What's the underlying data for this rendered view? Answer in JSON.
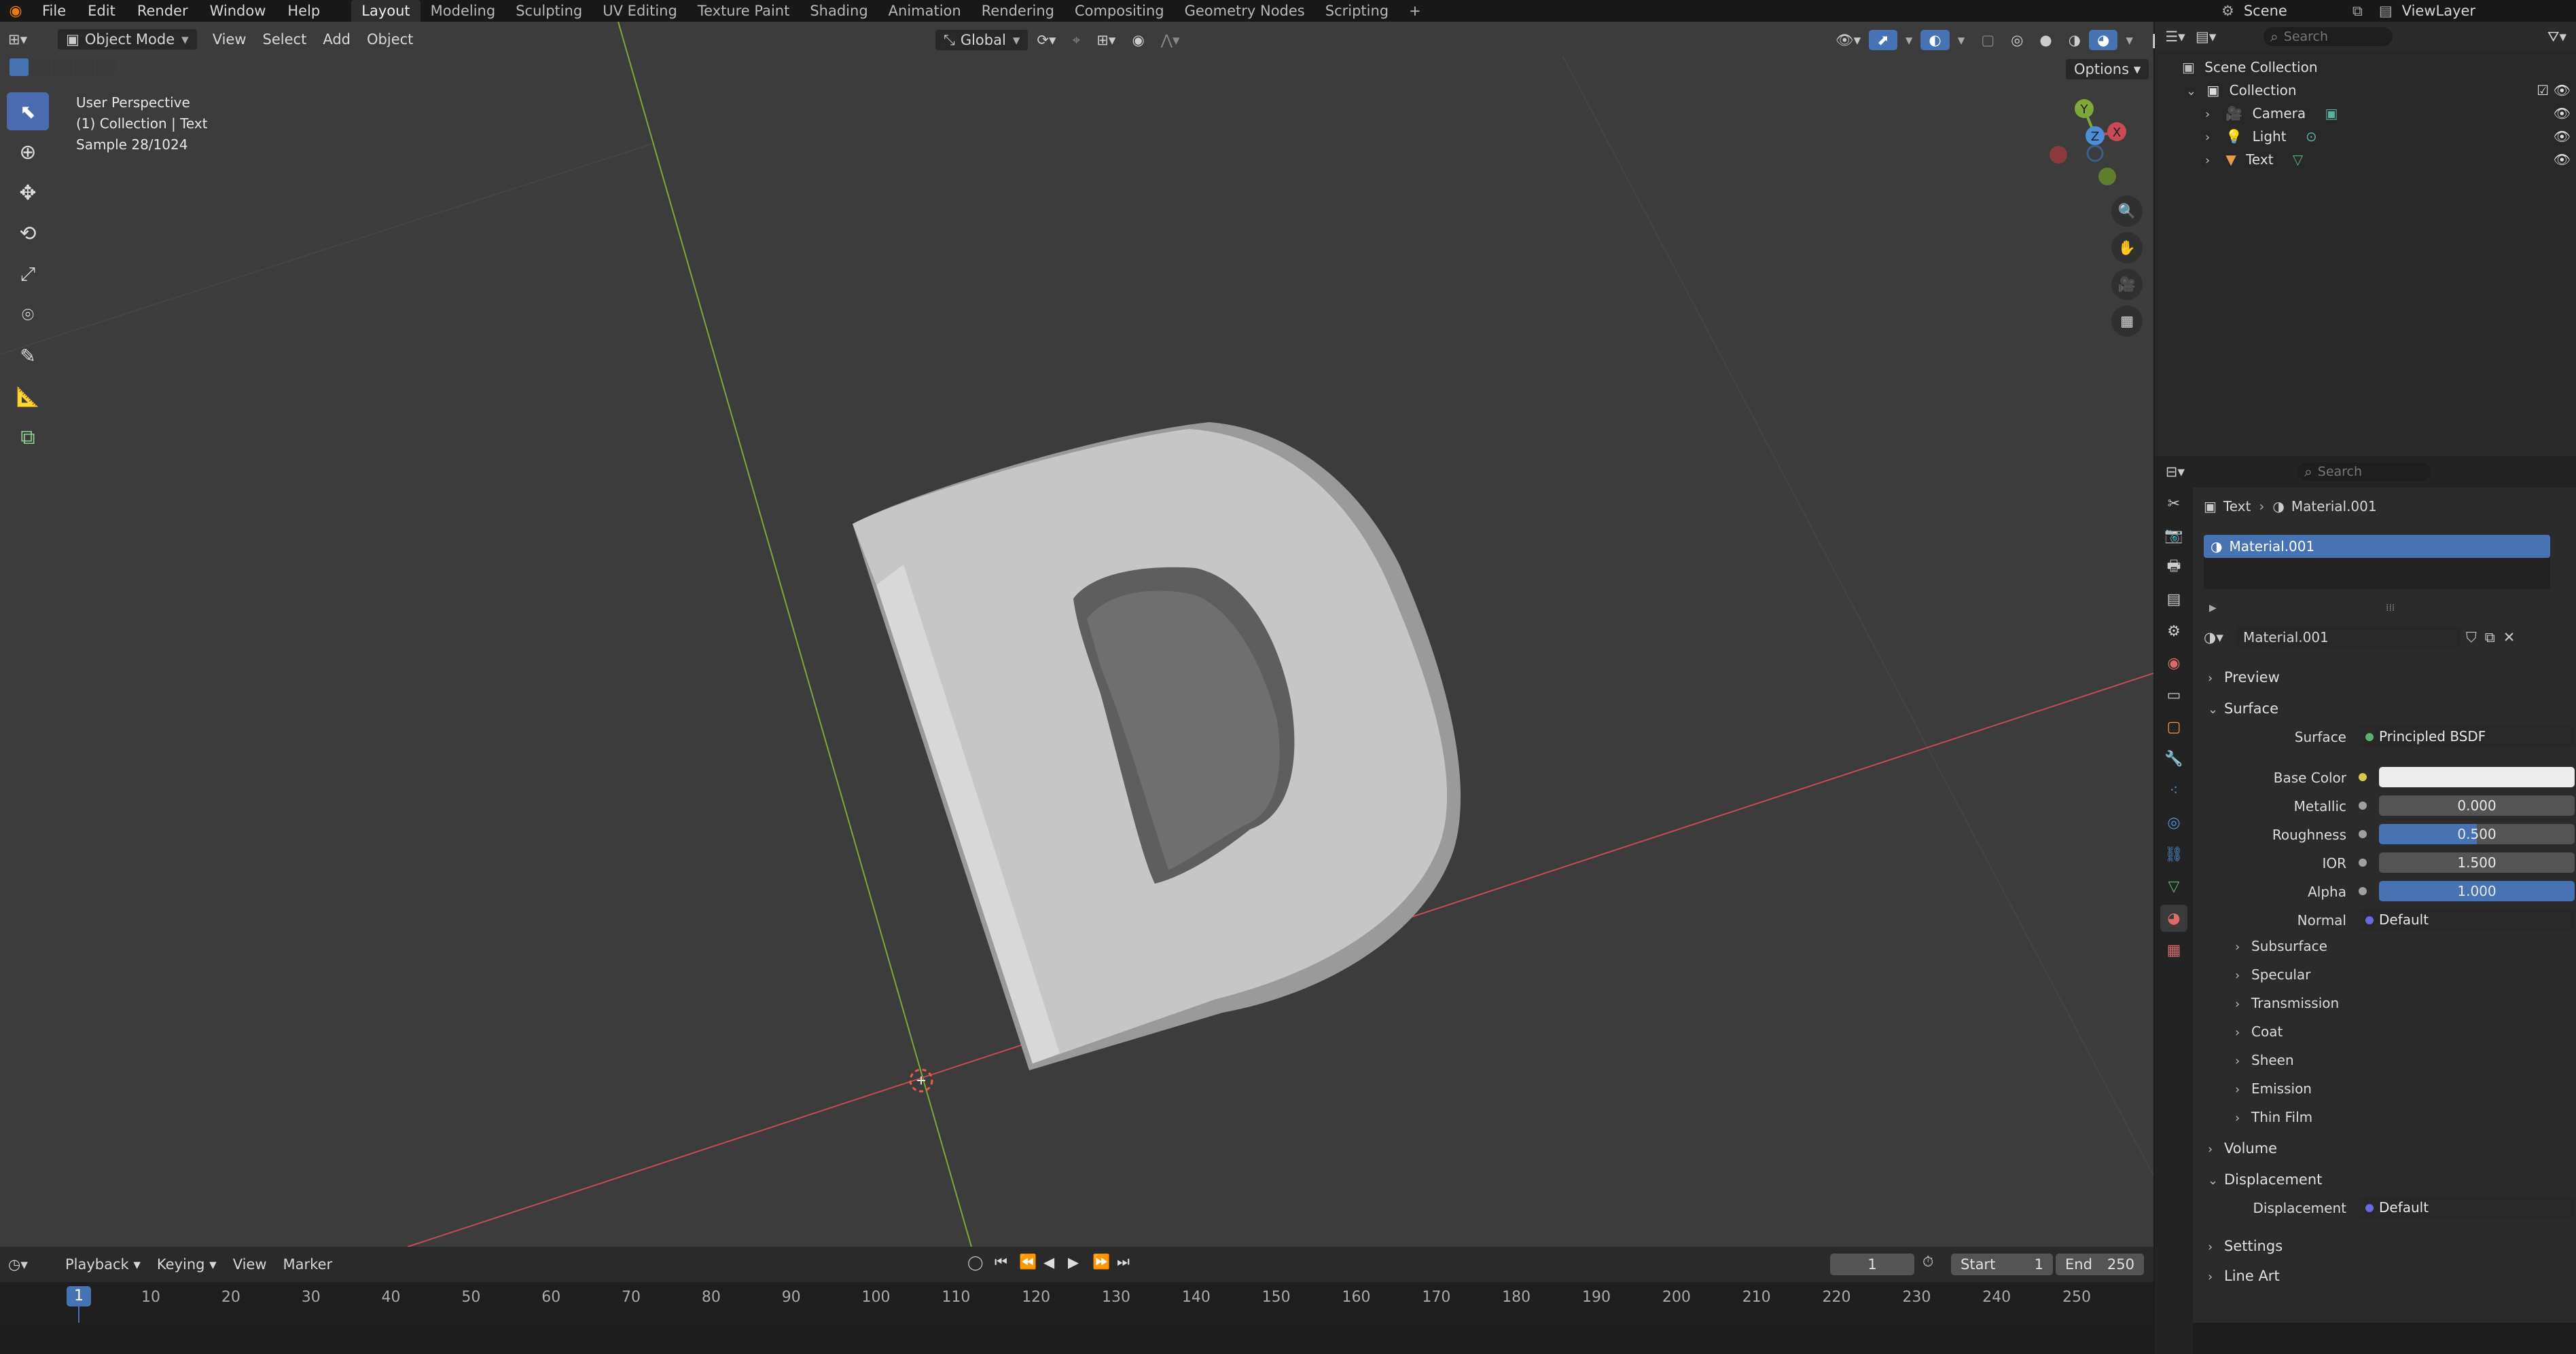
{
  "topbar": {
    "menus": [
      "File",
      "Edit",
      "Render",
      "Window",
      "Help"
    ],
    "workspaces": [
      "Layout",
      "Modeling",
      "Sculpting",
      "UV Editing",
      "Texture Paint",
      "Shading",
      "Animation",
      "Rendering",
      "Compositing",
      "Geometry Nodes",
      "Scripting"
    ],
    "add_tab": "+",
    "scene": "Scene",
    "view_layer": "ViewLayer"
  },
  "viewport": {
    "mode": "Object Mode",
    "menus": [
      "View",
      "Select",
      "Add",
      "Object"
    ],
    "transform_orientation": "Global",
    "options": "Options",
    "overlay_lines": [
      "User Perspective",
      "(1) Collection | Text",
      "Sample 28/1024"
    ],
    "gizmo": {
      "x": "X",
      "y": "Y",
      "z": "Z"
    }
  },
  "timeline": {
    "menus": [
      "Playback",
      "Keying",
      "View",
      "Marker"
    ],
    "current_frame": "1",
    "start_label": "Start",
    "start_value": "1",
    "end_label": "End",
    "end_value": "250",
    "ruler_current": "1",
    "ruler_ticks": [
      "10",
      "20",
      "30",
      "40",
      "50",
      "60",
      "70",
      "80",
      "90",
      "100",
      "110",
      "120",
      "130",
      "140",
      "150",
      "160",
      "170",
      "180",
      "190",
      "200",
      "210",
      "220",
      "230",
      "240",
      "250"
    ]
  },
  "outliner": {
    "search_placeholder": "Search",
    "root": "Scene Collection",
    "collection": "Collection",
    "items": [
      "Camera",
      "Light",
      "Text"
    ]
  },
  "properties": {
    "search_placeholder": "Search",
    "breadcrumb_object": "Text",
    "breadcrumb_material": "Material.001",
    "slot_name": "Material.001",
    "material_name": "Material.001",
    "preview": "Preview",
    "surface_panel": "Surface",
    "surface_label": "Surface",
    "surface_value": "Principled BSDF",
    "base_color_label": "Base Color",
    "metallic_label": "Metallic",
    "metallic_value": "0.000",
    "metallic": 0.0,
    "roughness_label": "Roughness",
    "roughness_value": "0.500",
    "roughness": 0.5,
    "ior_label": "IOR",
    "ior_value": "1.500",
    "alpha_label": "Alpha",
    "alpha_value": "1.000",
    "alpha": 1.0,
    "normal_label": "Normal",
    "normal_value": "Default",
    "subpanels": [
      "Subsurface",
      "Specular",
      "Transmission",
      "Coat",
      "Sheen",
      "Emission",
      "Thin Film"
    ],
    "volume": "Volume",
    "displacement_panel": "Displacement",
    "displacement_label": "Displacement",
    "displacement_value": "Default",
    "settings": "Settings",
    "line_art": "Line Art"
  },
  "colors": {
    "accent_blue": "#4772b3",
    "base_color": "#ececec",
    "x_axis": "#c94a55",
    "y_axis": "#7ea83a",
    "z_axis": "#4d8fd6"
  }
}
